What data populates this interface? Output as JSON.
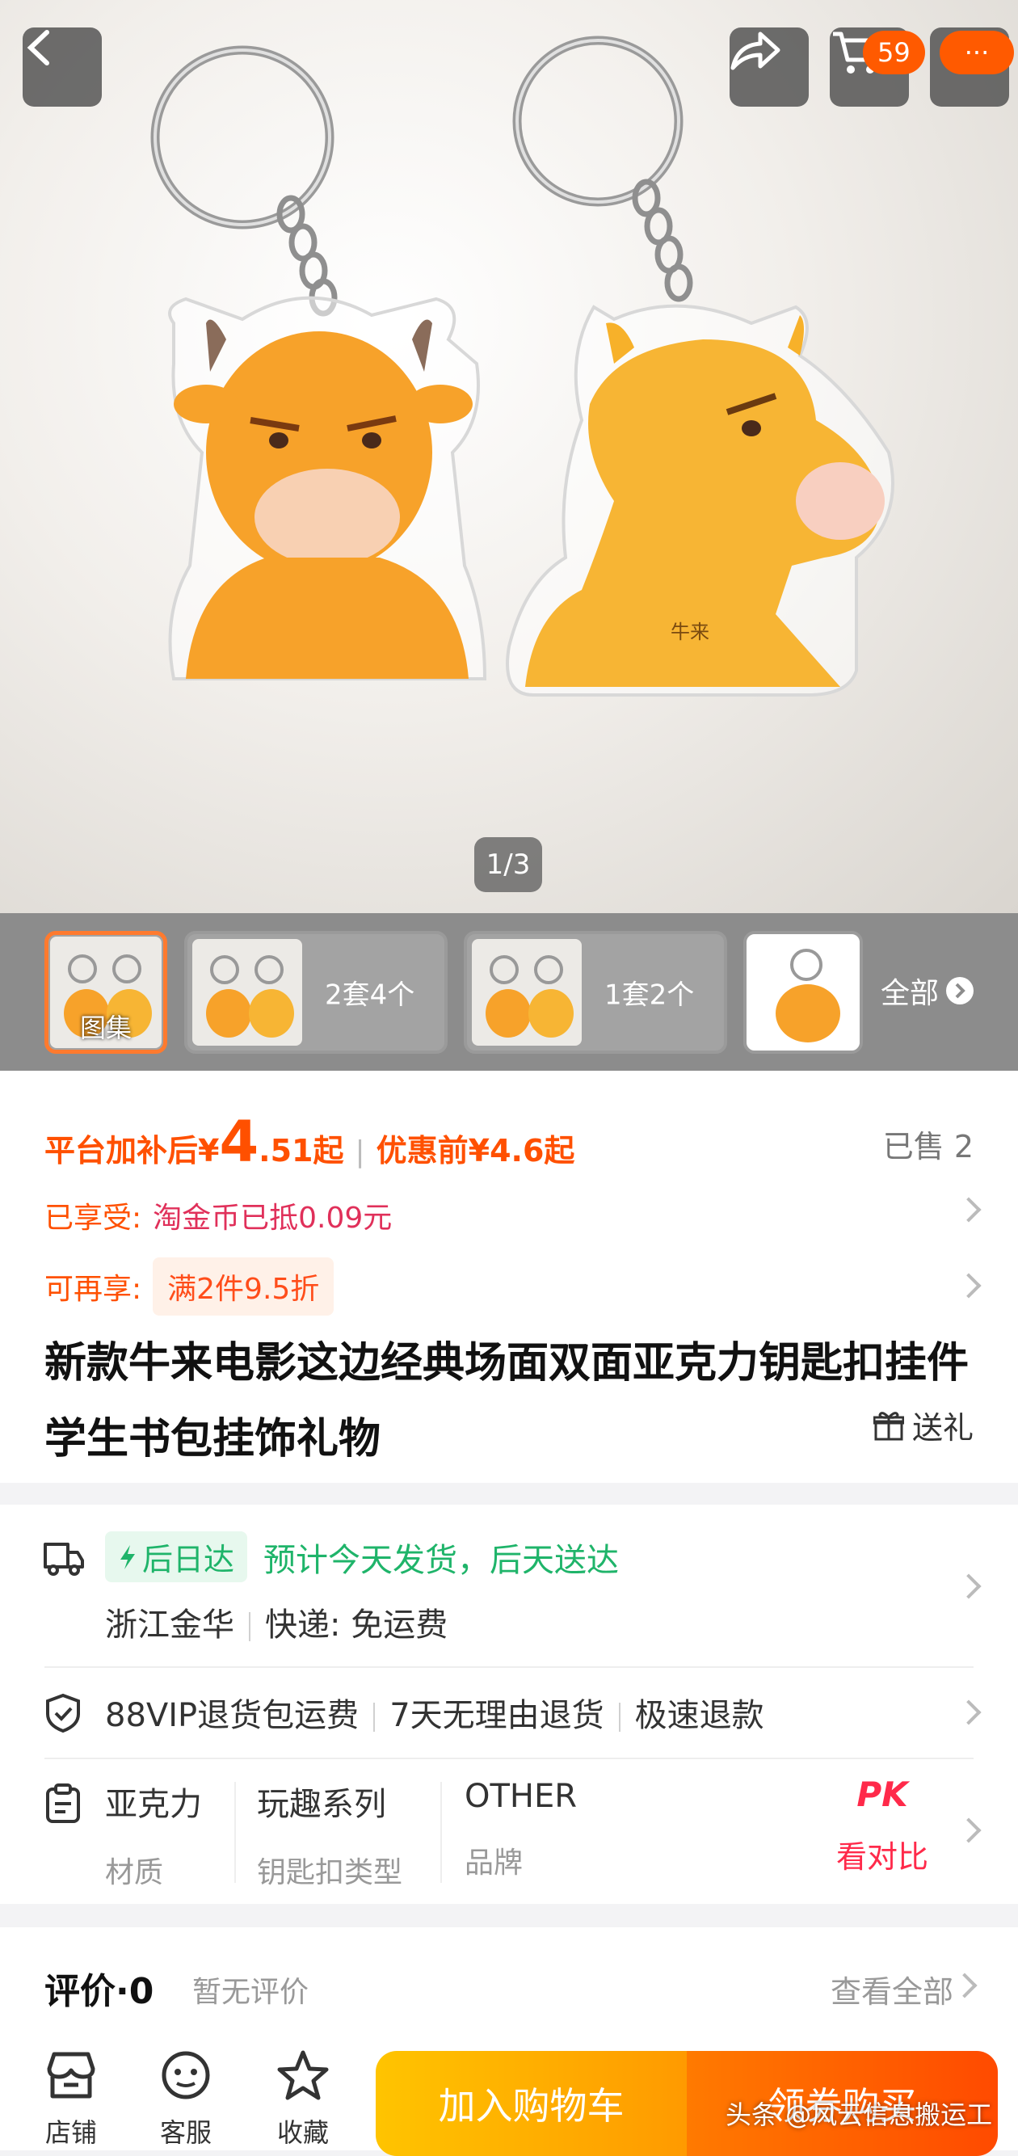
{
  "gallery": {
    "counter": "1/3",
    "cart_badge": "59",
    "more_badge": "···",
    "thumbnails": [
      {
        "caption": "图集"
      },
      {
        "label": "2套4个"
      },
      {
        "label": "1套2个"
      },
      {
        "label": ""
      }
    ],
    "all_label": "全部",
    "keychain_left_label": "",
    "keychain_right_label": "牛来"
  },
  "price": {
    "prefix": "平台加补后¥",
    "integer": "4",
    "decimal": ".51起",
    "original": "优惠前¥4.6起",
    "sold": "已售 2"
  },
  "promos": {
    "enjoyed_label": "已享受:",
    "enjoyed_value": "淘金币已抵0.09元",
    "more_label": "可再享:",
    "more_value": "满2件9.5折"
  },
  "product": {
    "title": "新款牛来电影这边经典场面双面亚克力钥匙扣挂件学生书包挂饰礼物",
    "gift_label": "送礼"
  },
  "shipping": {
    "badge": "后日达",
    "eta": "预计今天发货，后天送达",
    "origin": "浙江金华",
    "courier": "快递: 免运费"
  },
  "guarantee": {
    "items": [
      "88VIP退货包运费",
      "7天无理由退货",
      "极速退款"
    ]
  },
  "specs": {
    "items": [
      {
        "value": "亚克力",
        "key": "材质"
      },
      {
        "value": "玩趣系列",
        "key": "钥匙扣类型"
      },
      {
        "value": "OTHER",
        "key": "品牌"
      }
    ],
    "pk_label": "PK",
    "compare_label": "看对比"
  },
  "reviews": {
    "title": "评价·0",
    "empty": "暂无评价",
    "view_all": "查看全部"
  },
  "bottom_bar": {
    "store": "店铺",
    "service": "客服",
    "favorite": "收藏",
    "add_cart": "加入购物车",
    "buy_now": "领券购买"
  },
  "watermark": "头条 @风云信息搬运工",
  "colors": {
    "accent": "#ff5000",
    "green": "#1fb46a",
    "pk": "#ff2a4a"
  }
}
